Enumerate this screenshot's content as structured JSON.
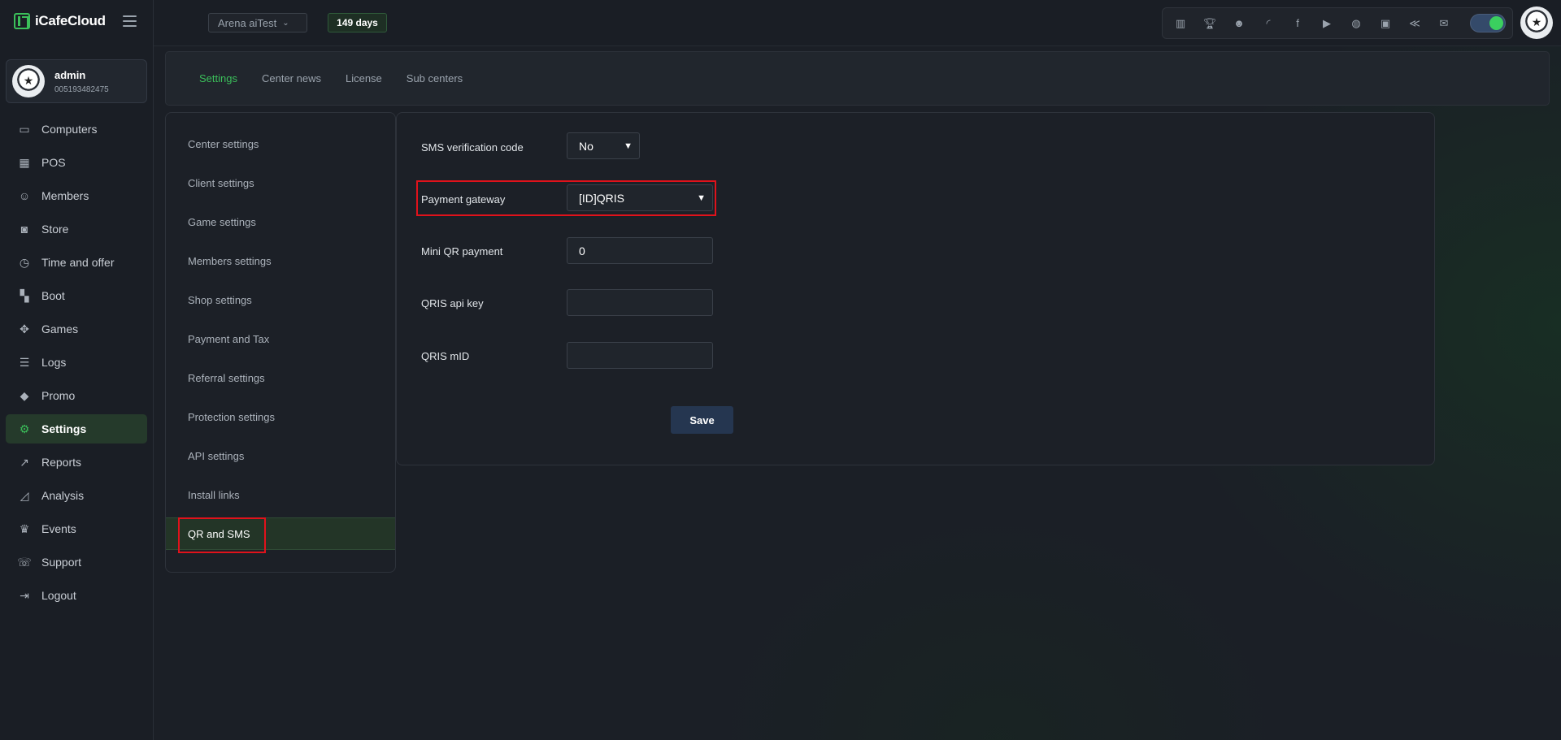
{
  "app": {
    "brand": "iCafeCloud"
  },
  "user": {
    "name": "admin",
    "id": "005193482475"
  },
  "topbar": {
    "center_name": "Arena aiTest",
    "days_badge": "149 days",
    "tray_icons": [
      "leaderboard-icon",
      "trophy-icon",
      "community-icon",
      "rss-icon",
      "facebook-icon",
      "youtube-icon",
      "globe-icon",
      "icafe-icon",
      "handshake-icon",
      "mail-icon"
    ],
    "theme_toggle": "on"
  },
  "sidebar": {
    "items": [
      {
        "label": "Computers",
        "icon": "monitor-icon",
        "glyph": "▭",
        "active": false
      },
      {
        "label": "POS",
        "icon": "cash-register-icon",
        "glyph": "▦",
        "active": false
      },
      {
        "label": "Members",
        "icon": "members-icon",
        "glyph": "☺",
        "active": false
      },
      {
        "label": "Store",
        "icon": "shopping-bag-icon",
        "glyph": "◙",
        "active": false
      },
      {
        "label": "Time and offer",
        "icon": "stopwatch-icon",
        "glyph": "◷",
        "active": false
      },
      {
        "label": "Boot",
        "icon": "windows-icon",
        "glyph": "▚",
        "active": false
      },
      {
        "label": "Games",
        "icon": "gamepad-icon",
        "glyph": "✥",
        "active": false
      },
      {
        "label": "Logs",
        "icon": "list-icon",
        "glyph": "☰",
        "active": false
      },
      {
        "label": "Promo",
        "icon": "tag-icon",
        "glyph": "◆",
        "active": false
      },
      {
        "label": "Settings",
        "icon": "gear-icon",
        "glyph": "⚙",
        "active": true
      },
      {
        "label": "Reports",
        "icon": "line-chart-icon",
        "glyph": "↗",
        "active": false
      },
      {
        "label": "Analysis",
        "icon": "area-chart-icon",
        "glyph": "◿",
        "active": false
      },
      {
        "label": "Events",
        "icon": "crown-icon",
        "glyph": "♛",
        "active": false
      },
      {
        "label": "Support",
        "icon": "phone-icon",
        "glyph": "☏",
        "active": false
      },
      {
        "label": "Logout",
        "icon": "logout-icon",
        "glyph": "⇥",
        "active": false
      }
    ]
  },
  "tabs": [
    {
      "label": "Settings",
      "active": true
    },
    {
      "label": "Center news",
      "active": false
    },
    {
      "label": "License",
      "active": false
    },
    {
      "label": "Sub centers",
      "active": false
    }
  ],
  "settings_menu": [
    {
      "label": "Center settings",
      "active": false
    },
    {
      "label": "Client settings",
      "active": false
    },
    {
      "label": "Game settings",
      "active": false
    },
    {
      "label": "Members settings",
      "active": false
    },
    {
      "label": "Shop settings",
      "active": false
    },
    {
      "label": "Payment and Tax",
      "active": false
    },
    {
      "label": "Referral settings",
      "active": false
    },
    {
      "label": "Protection settings",
      "active": false
    },
    {
      "label": "API settings",
      "active": false
    },
    {
      "label": "Install links",
      "active": false
    },
    {
      "label": "QR and SMS",
      "active": true
    }
  ],
  "form": {
    "sms_verification": {
      "label": "SMS verification code",
      "value": "No"
    },
    "payment_gateway": {
      "label": "Payment gateway",
      "value": "[ID]QRIS"
    },
    "mini_qr_payment": {
      "label": "Mini QR payment",
      "value": "0"
    },
    "qris_api_key": {
      "label": "QRIS api key",
      "value": ""
    },
    "qris_mid": {
      "label": "QRIS mID",
      "value": ""
    },
    "save_label": "Save"
  },
  "colors": {
    "accent": "#3bbf5a",
    "highlight": "#e0121b",
    "save_button": "#253650"
  }
}
